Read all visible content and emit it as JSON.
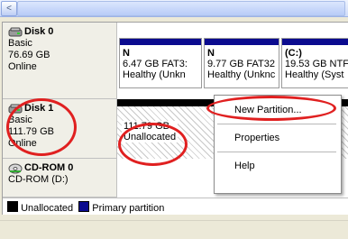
{
  "colors": {
    "primary_partition": "#0b0b8f",
    "unallocated": "#000000",
    "highlight_circle": "#e02020"
  },
  "scrollbar": {
    "left_arrow": "<"
  },
  "disks": [
    {
      "name": "Disk 0",
      "type": "Basic",
      "size": "76.69 GB",
      "status": "Online",
      "icon": "disk-icon",
      "volumes": [
        {
          "label": "N",
          "line2": "6.47 GB FAT3:",
          "line3": "Healthy (Unkn"
        },
        {
          "label": "N",
          "line2": "9.77 GB FAT32",
          "line3": "Healthy (Unknc"
        },
        {
          "label": "(C:)",
          "line2": "19.53 GB NTF",
          "line3": "Healthy (Syst"
        }
      ]
    },
    {
      "name": "Disk 1",
      "type": "Basic",
      "size": "111.79 GB",
      "status": "Online",
      "icon": "disk-icon",
      "unallocated": {
        "size": "111.79 GB",
        "label": "Unallocated"
      }
    },
    {
      "name": "CD-ROM 0",
      "drive": "CD-ROM (D:)",
      "icon": "cdrom-icon"
    }
  ],
  "legend": {
    "unallocated": "Unallocated",
    "primary": "Primary partition"
  },
  "context_menu": {
    "items": [
      "New Partition...",
      "Properties",
      "Help"
    ]
  }
}
